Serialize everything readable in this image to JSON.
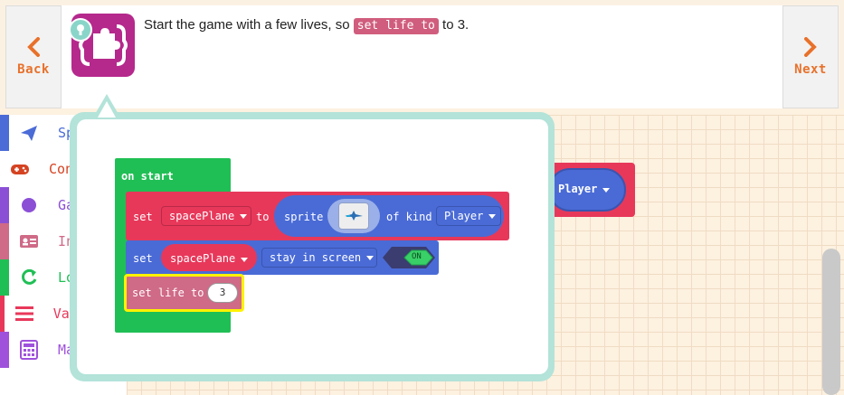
{
  "tutorial": {
    "back_label": "Back",
    "next_label": "Next",
    "text_before": "Start the game with a few lives, so ",
    "text_chip": "set life to",
    "text_after": " to 3."
  },
  "toolbox": {
    "categories": [
      {
        "label": "Sprites",
        "color": "#4b6cd7",
        "icon": "paper-plane-icon"
      },
      {
        "label": "Controller",
        "color": "#d54322",
        "icon": "gamepad-icon"
      },
      {
        "label": "Game",
        "color": "#8b4fd6",
        "icon": "circle-icon"
      },
      {
        "label": "Info",
        "color": "#cf6a87",
        "icon": "id-card-icon"
      },
      {
        "label": "Loops",
        "color": "#20bf55",
        "icon": "refresh-icon"
      },
      {
        "label": "Variables",
        "color": "#e8385a",
        "icon": "list-icon"
      },
      {
        "label": "Math",
        "color": "#9f51dc",
        "icon": "calculator-icon"
      }
    ]
  },
  "workspace": {
    "background_block_label": "Player"
  },
  "popup": {
    "on_start": "on start",
    "row1": {
      "set": "set",
      "var": "spacePlane",
      "to": "to",
      "sprite": "sprite",
      "of_kind": "of kind",
      "kind": "Player"
    },
    "row2": {
      "set": "set",
      "var": "spacePlane",
      "flag": "stay in screen",
      "toggle": "ON"
    },
    "row3": {
      "label": "set life to",
      "value": "3"
    }
  },
  "colors": {
    "accent": "#e8712b",
    "event_green": "#20bf55",
    "sprite_red": "#e7385a",
    "sprite_blue": "#4a6bd6",
    "info_pink": "#cf6a87",
    "highlight": "#fff200"
  }
}
